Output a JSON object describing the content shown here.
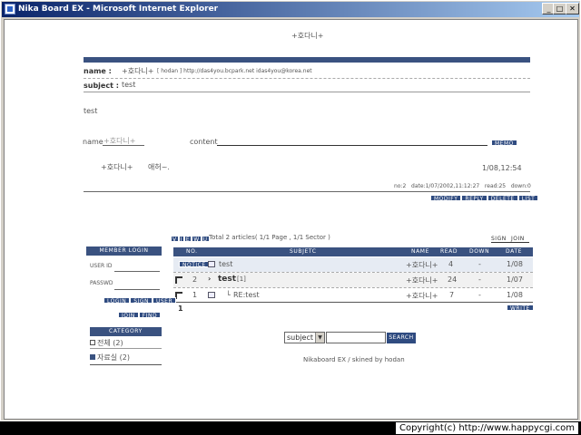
{
  "window": {
    "title": "Nika Board EX - Microsoft Internet Explorer",
    "min": "_",
    "max": "□",
    "close": "✕"
  },
  "header_nick": "+호다니+",
  "post": {
    "name_label": "name :",
    "name_value": "+호다니+",
    "name_links": "[ hodan ] http://das4you.bcpark.net idas4you@korea.net",
    "subject_label": "subject :",
    "subject_value": "test",
    "body": "test"
  },
  "comment_form": {
    "name_label": "name",
    "name_value": "+호다니+",
    "content_label": "content",
    "submit": "MEMO"
  },
  "comment": {
    "author": "+호다니+",
    "text": "애허~.",
    "date": "1/08,12:54"
  },
  "post_meta": "no:2   date:1/07/2002,11:12:27   read:25   down:0",
  "post_buttons": [
    "MODIFY",
    "REPLY",
    "DELETE",
    "LIST"
  ],
  "view_icons": [
    "V",
    "I",
    "E",
    "W",
    "U"
  ],
  "summary": "Total 2 articles( 1/1 Page , 1/1 Sector )",
  "top_links": [
    "SIGN",
    "JOIN"
  ],
  "table": {
    "headers": {
      "no": "NO.",
      "subject": "SUBJETC",
      "name": "NAME",
      "read": "READ",
      "down": "DOWN",
      "date": "DATE"
    },
    "rows": [
      {
        "no": "NOTICE",
        "subject": "test",
        "name": "+호다니+",
        "read": "4",
        "down": "-",
        "date": "1/08"
      },
      {
        "no": "2",
        "subject": "test",
        "count": "[1]",
        "name": "+호다니+",
        "read": "24",
        "down": "-",
        "date": "1/07"
      },
      {
        "no": "1",
        "subject": "RE:test",
        "name": "+호다니+",
        "read": "7",
        "down": "-",
        "date": "1/08"
      }
    ],
    "page": "1",
    "write": "WRITE"
  },
  "login": {
    "title": "MEMBER LOGIN",
    "userid_label": "USER ID",
    "password_label": "PASSWD",
    "buttons": [
      "LOGIN",
      "SIGN",
      "USER"
    ],
    "buttons2": [
      "JOIN",
      "FIND"
    ]
  },
  "category": {
    "title": "CATEGORY",
    "items": [
      {
        "label": "전체 (2)"
      },
      {
        "label": "자료실 (2)"
      }
    ]
  },
  "search": {
    "select_value": "subject",
    "button": "SEARCH"
  },
  "footer": "Nikaboard EX / skined by hodan",
  "copyright": "Copyright(c) http://www.happycgi.com"
}
